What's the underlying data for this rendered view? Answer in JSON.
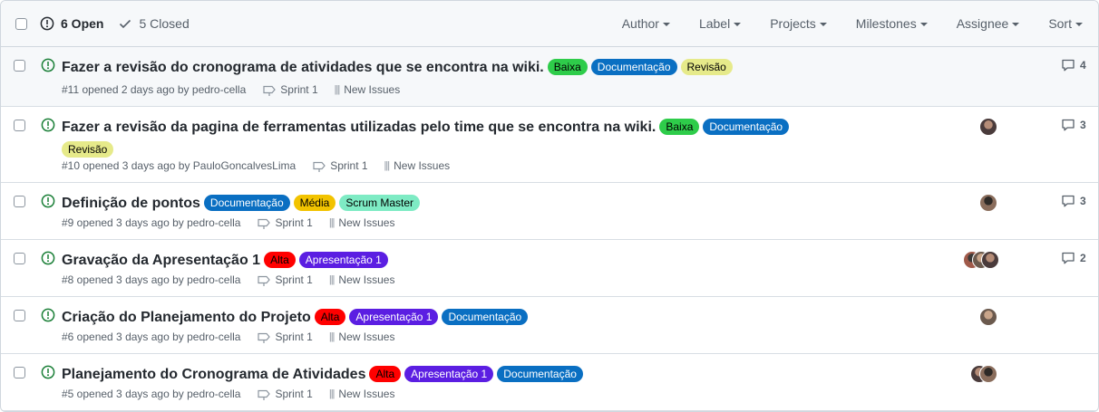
{
  "header": {
    "open_label": "6 Open",
    "closed_label": "5 Closed",
    "filters": [
      "Author",
      "Label",
      "Projects",
      "Milestones",
      "Assignee",
      "Sort"
    ]
  },
  "label_colors": {
    "Baixa": {
      "bg": "#2ecc4a",
      "fg": "#000000"
    },
    "Documentação": {
      "bg": "#0a6fc2",
      "fg": "#ffffff"
    },
    "Revisão": {
      "bg": "#e6ea8a",
      "fg": "#000000"
    },
    "Média": {
      "bg": "#f2c300",
      "fg": "#000000"
    },
    "Scrum Master": {
      "bg": "#7eebc4",
      "fg": "#000000"
    },
    "Alta": {
      "bg": "#ff0000",
      "fg": "#000000"
    },
    "Apresentação 1": {
      "bg": "#5b1ee2",
      "fg": "#ffffff"
    }
  },
  "issues": [
    {
      "title": "Fazer a revisão do cronograma de atividades que se encontra na wiki.",
      "labels": [
        "Baixa",
        "Documentação",
        "Revisão"
      ],
      "meta": "#11 opened 2 days ago by pedro-cella",
      "milestone": "Sprint 1",
      "project": "New Issues",
      "comments": "4",
      "assignees": 0
    },
    {
      "title": "Fazer a revisão da pagina de ferramentas utilizadas pelo time que se encontra na wiki.",
      "labels": [
        "Baixa",
        "Documentação",
        "Revisão"
      ],
      "meta": "#10 opened 3 days ago by PauloGoncalvesLima",
      "milestone": "Sprint 1",
      "project": "New Issues",
      "comments": "3",
      "assignees": 1
    },
    {
      "title": "Definição de pontos",
      "labels": [
        "Documentação",
        "Média",
        "Scrum Master"
      ],
      "meta": "#9 opened 3 days ago by pedro-cella",
      "milestone": "Sprint 1",
      "project": "New Issues",
      "comments": "3",
      "assignees": 1
    },
    {
      "title": "Gravação da Apresentação 1",
      "labels": [
        "Alta",
        "Apresentação 1"
      ],
      "meta": "#8 opened 3 days ago by pedro-cella",
      "milestone": "Sprint 1",
      "project": "New Issues",
      "comments": "2",
      "assignees": 3
    },
    {
      "title": "Criação do Planejamento do Projeto",
      "labels": [
        "Alta",
        "Apresentação 1",
        "Documentação"
      ],
      "meta": "#6 opened 3 days ago by pedro-cella",
      "milestone": "Sprint 1",
      "project": "New Issues",
      "comments": "",
      "assignees": 1
    },
    {
      "title": "Planejamento do Cronograma de Atividades",
      "labels": [
        "Alta",
        "Apresentação 1",
        "Documentação"
      ],
      "meta": "#5 opened 3 days ago by pedro-cella",
      "milestone": "Sprint 1",
      "project": "New Issues",
      "comments": "",
      "assignees": 2
    }
  ]
}
